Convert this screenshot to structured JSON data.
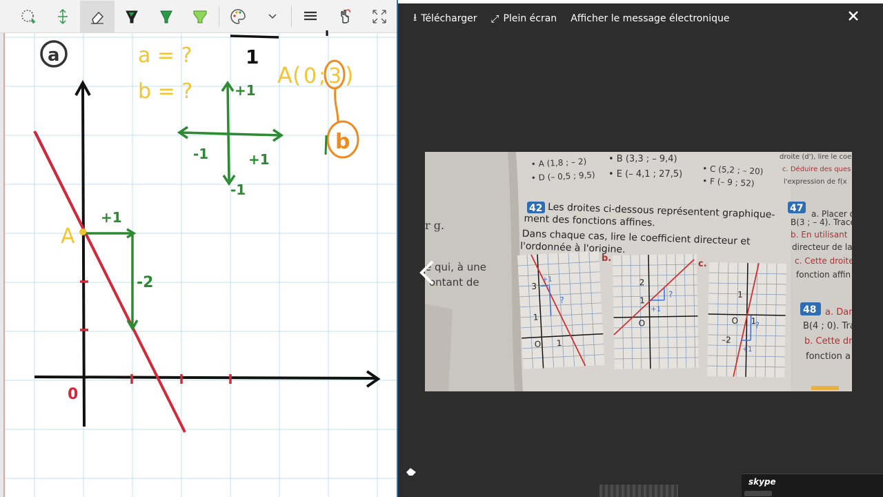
{
  "viewer": {
    "download_label": "Télécharger",
    "fullscreen_label": "Plein écran",
    "show_email_label": "Afficher le message électronique"
  },
  "whiteboard": {
    "circle_label": "a",
    "a_question": "a = ?",
    "b_question": "b = ?",
    "top_one": "1",
    "point_a_label": "A(0 ; 3)",
    "point_a_x": "0",
    "point_a_y": "3",
    "b_label": "b",
    "plus_one_up": "+1",
    "minus_one_left": "-1",
    "plus_one_right": "+1",
    "minus_one_down": "-1",
    "step_plus_one": "+1",
    "step_minus_two": "-2",
    "point_a": "A",
    "origin": "0"
  },
  "photo": {
    "top_left_1": "• A (1,8 ; – 2)",
    "top_left_2": "• D (– 0,5 ; 9,5)",
    "top_mid_1": "• B (3,3 ; – 9,4)",
    "top_mid_2": "• E (– 4,1 ; 27,5)",
    "top_mid3_1": "• C (5,2 ; – 20)",
    "top_mid3_2": "• F (– 9 ; 52)",
    "right_col_1": "droite (d'), lire le coef",
    "right_col_2": "c. Déduire des ques",
    "right_col_3": "l'expression de f(x",
    "ex42_num": "42",
    "ex42_line1": "Les droites ci-dessous représentent graphique-",
    "ex42_line2": "ment des fonctions affines.",
    "ex42_line3": "Dans chaque cas, lire le coefficient directeur et",
    "ex42_line4": "l'ordonnée à l'origine.",
    "ex47_num": "47",
    "ex47_line1": "a. Placer d",
    "ex47_line2": "B(3 ; – 4). Tracer",
    "ex47_line3": "b. En utilisant",
    "ex47_line4": "directeur de la",
    "ex47_line5": "c. Cette droite",
    "ex47_line6": "fonction affin",
    "ex48_num": "48",
    "ex48_line1": "a. Dan",
    "ex48_line2": "B(4 ; 0). Tra",
    "ex48_line3": "b. Cette dr",
    "ex48_line4": "fonction a",
    "left_frag_1": "r g.",
    "left_frag_2": "e qui, à une",
    "left_frag_3": "ontant de",
    "graph_a": "a.",
    "graph_b": "b.",
    "graph_c": "c.",
    "ga_3": "3",
    "ga_1": "1",
    "ga_o": "O",
    "ga_x1": "1",
    "ga_plus": "+1",
    "ga_q": "?",
    "gb_2": "2",
    "gb_1": "1",
    "gb_o": "O",
    "gb_plus": "+1",
    "gb_q": "?",
    "gc_1": "1",
    "gc_o": "O",
    "gc_x1": "1",
    "gc_m2": "–2",
    "gc_plus": "+1",
    "gc_q": "?"
  },
  "skype": {
    "logo": "skype"
  }
}
